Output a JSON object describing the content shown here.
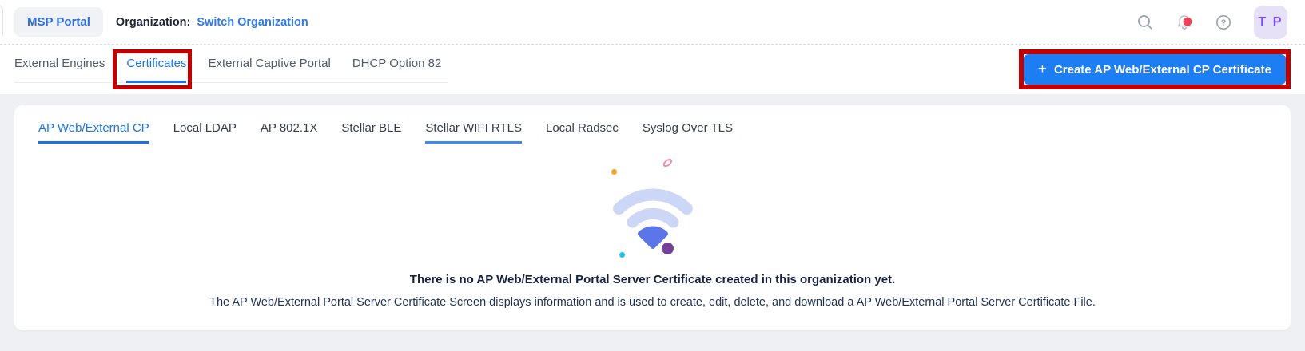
{
  "header": {
    "portal_label": "MSP Portal",
    "organization_label": "Organization:",
    "organization_link": "Switch Organization",
    "avatar_initials": "T P"
  },
  "tabs": {
    "items": [
      {
        "label": "External Engines",
        "active": false
      },
      {
        "label": "Certificates",
        "active": true,
        "annotated": true
      },
      {
        "label": "External Captive Portal",
        "active": false
      },
      {
        "label": "DHCP Option 82",
        "active": false
      }
    ]
  },
  "create_button": {
    "plus": "+",
    "label": "Create AP Web/External CP Certificate",
    "annotated": true
  },
  "subtabs": [
    {
      "label": "AP Web/External CP",
      "active": true
    },
    {
      "label": "Local LDAP",
      "active": false
    },
    {
      "label": "AP 802.1X",
      "active": false
    },
    {
      "label": "Stellar BLE",
      "active": false
    },
    {
      "label": "Stellar WIFI RTLS",
      "active": false,
      "underlined": true
    },
    {
      "label": "Local Radsec",
      "active": false
    },
    {
      "label": "Syslog Over TLS",
      "active": false
    }
  ],
  "empty_state": {
    "icon": "wifi-icon",
    "title": "There is no AP Web/External Portal Server Certificate created in this organization yet.",
    "description": "The AP Web/External Portal Server Certificate Screen displays information and is used to create, edit, delete, and download a AP Web/External Portal Server Certificate File."
  },
  "colors": {
    "accent_blue": "#1a73e8",
    "button_blue": "#1d7df2",
    "annotation_red": "#c20000",
    "notification_red": "#f2415a",
    "avatar_purple": "#7a4ff0",
    "wifi_arc": "#ccd6f6",
    "wifi_wedge": "#5b76e8",
    "page_background": "#eef0f4"
  }
}
